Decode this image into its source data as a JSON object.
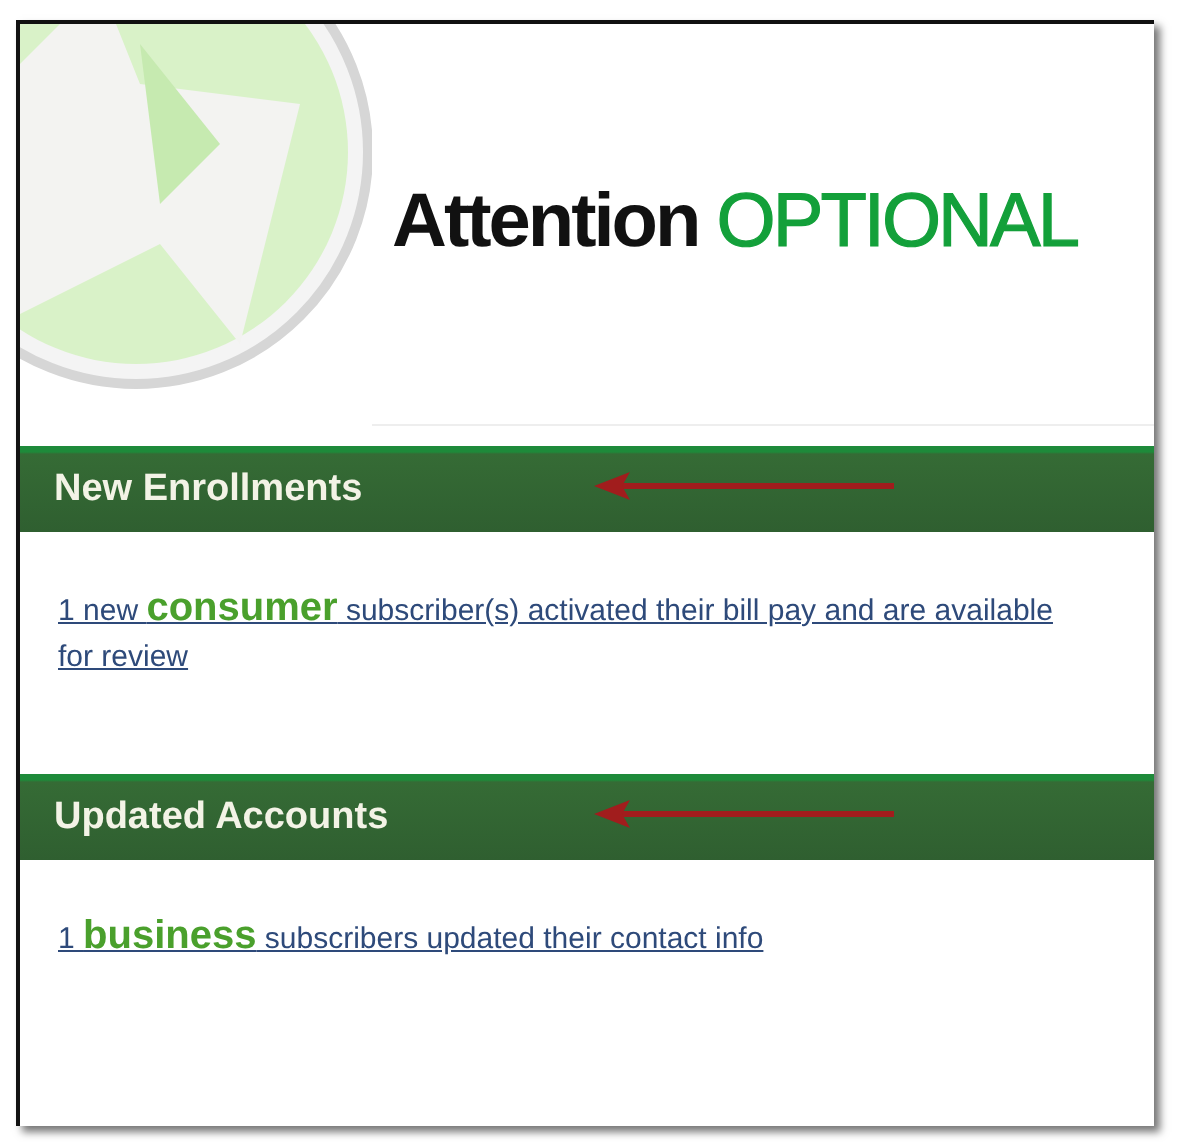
{
  "title": {
    "text": "Attention",
    "highlight": "OPTIONAL"
  },
  "sections": [
    {
      "heading": "New Enrollments",
      "annotated": true,
      "link": "1 new **consumer** subscriber(s) activated their bill pay and are available for review"
    },
    {
      "heading": "Updated Accounts",
      "annotated": true,
      "link": "1 **business** subscribers updated their contact info"
    }
  ]
}
